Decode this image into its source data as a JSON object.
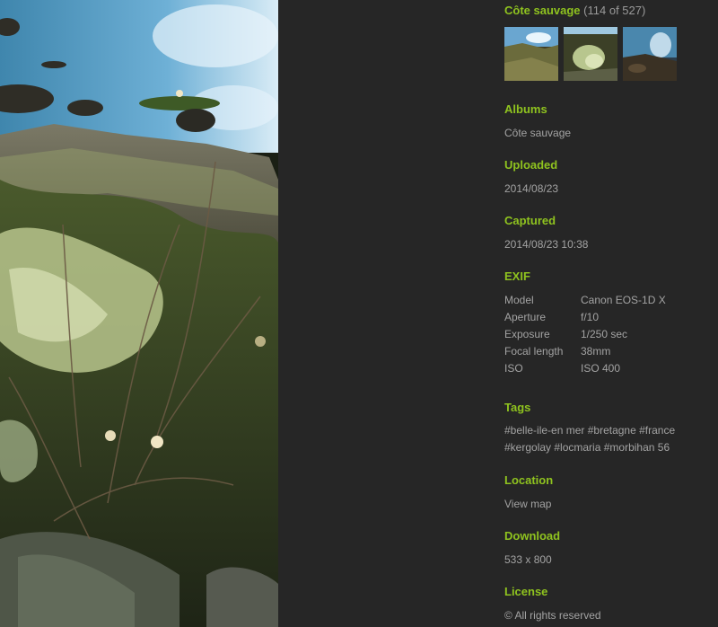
{
  "album": {
    "title": "Côte sauvage",
    "count": "(114 of 527)"
  },
  "thumbnails": [
    {
      "label": "thumbnail-1"
    },
    {
      "label": "thumbnail-2"
    },
    {
      "label": "thumbnail-3"
    }
  ],
  "albums": {
    "title": "Albums",
    "value": "Côte sauvage"
  },
  "uploaded": {
    "title": "Uploaded",
    "value": "2014/08/23"
  },
  "captured": {
    "title": "Captured",
    "value": "2014/08/23 10:38"
  },
  "exif": {
    "title": "EXIF",
    "rows": [
      {
        "key": "Model",
        "value": "Canon EOS-1D X"
      },
      {
        "key": "Aperture",
        "value": "f/10"
      },
      {
        "key": "Exposure",
        "value": "1/250 sec"
      },
      {
        "key": "Focal length",
        "value": "38mm"
      },
      {
        "key": "ISO",
        "value": "ISO 400"
      }
    ]
  },
  "tags": {
    "title": "Tags",
    "items": [
      "#belle-ile-en mer",
      "#bretagne",
      "#france",
      "#kergolay",
      "#locmaria",
      "#morbihan 56"
    ]
  },
  "location": {
    "title": "Location",
    "link": "View map"
  },
  "download": {
    "title": "Download",
    "value": "533 x 800"
  },
  "license": {
    "title": "License",
    "value": "© All rights reserved"
  },
  "colors": {
    "accent": "#8fc31f",
    "text": "#a3a3a3",
    "background": "#262626"
  }
}
